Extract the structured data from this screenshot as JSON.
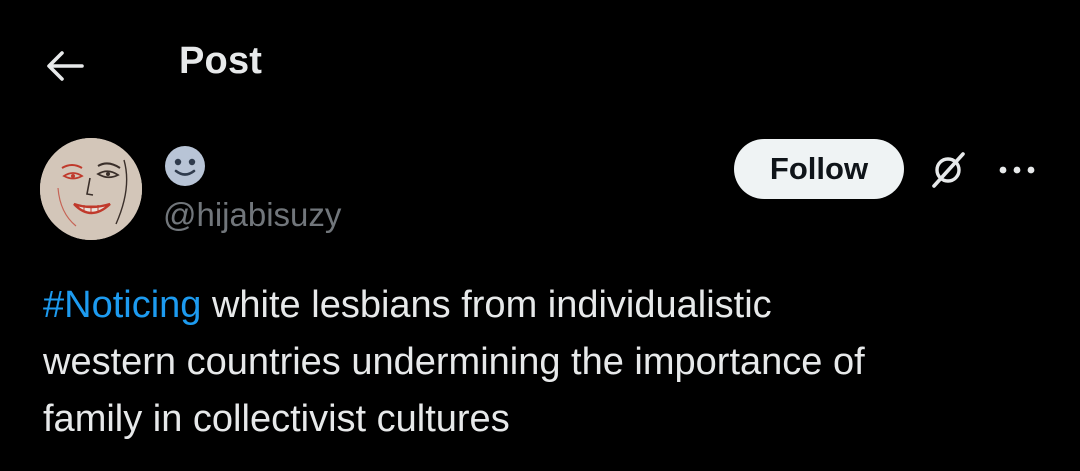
{
  "header": {
    "back_icon": "arrow-left-icon",
    "title": "Post"
  },
  "author": {
    "avatar_icon": "user-avatar",
    "display_name_icon": "smiling-face-emoji-icon",
    "handle": "@hijabisuzy",
    "follow_label": "Follow",
    "grok_icon": "grok-icon",
    "more_icon": "more-horizontal-icon"
  },
  "post": {
    "hashtag": "#Noticing",
    "line1_rest": " white lesbians from individualistic",
    "line2": "western countries undermining the importance of",
    "line3": "family in collectivist cultures"
  },
  "colors": {
    "background": "#000000",
    "text": "#e7e9ea",
    "secondary_text": "#71767b",
    "link": "#1d9bf0",
    "follow_button_bg": "#eff3f4",
    "follow_button_text": "#0f1419"
  }
}
